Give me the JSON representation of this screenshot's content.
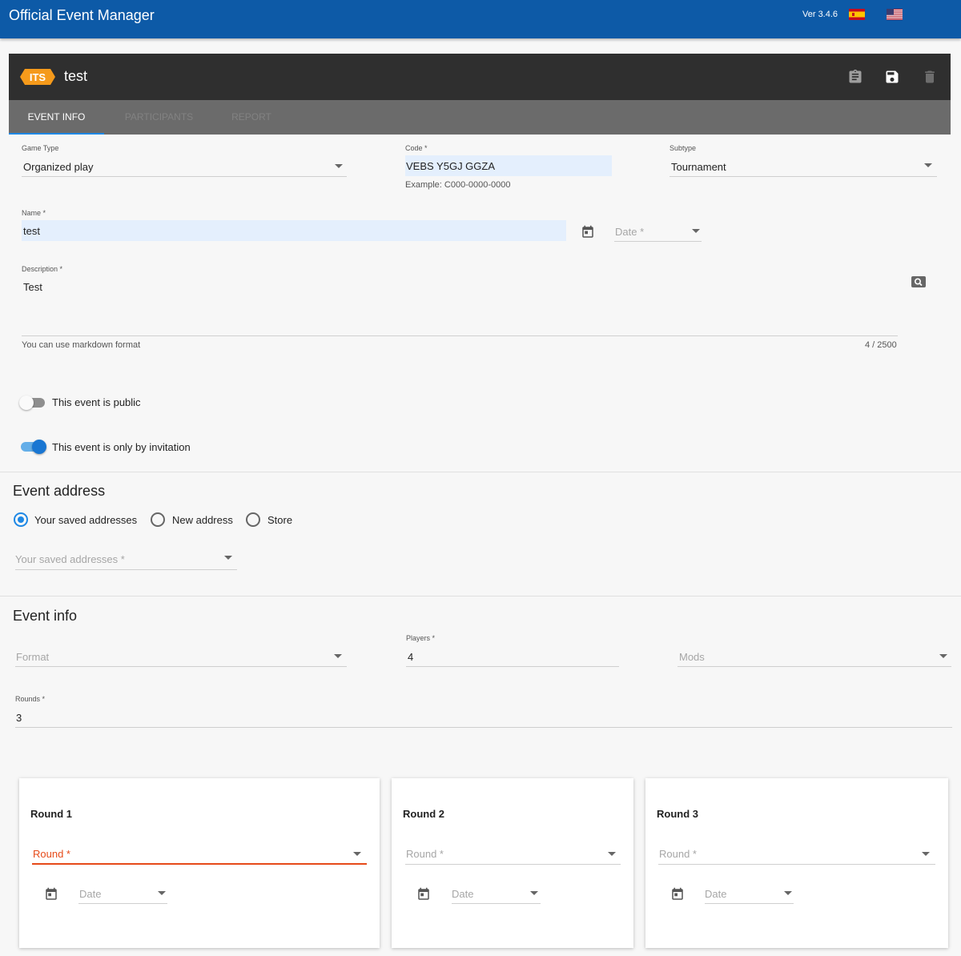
{
  "app": {
    "title": "Official Event Manager",
    "version": "Ver 3.4.6",
    "languages": [
      "es-flag-icon",
      "us-flag-icon"
    ]
  },
  "event_header": {
    "logo_text": "ITS",
    "title": "test",
    "actions": [
      "clipboard-icon",
      "save-icon",
      "delete-icon"
    ],
    "tabs": [
      {
        "label": "EVENT INFO",
        "active": true
      },
      {
        "label": "PARTICIPANTS",
        "active": false
      },
      {
        "label": "REPORT",
        "active": false
      }
    ]
  },
  "form": {
    "game_type": {
      "label": "Game Type",
      "value": "Organized play"
    },
    "code": {
      "label": "Code *",
      "value": "VEBS Y5GJ GGZA",
      "hint": "Example: C000-0000-0000"
    },
    "subtype": {
      "label": "Subtype",
      "value": "Tournament"
    },
    "name": {
      "label": "Name *",
      "value": "test"
    },
    "date": {
      "placeholder": "Date *"
    },
    "description": {
      "label": "Description *",
      "value": "Test",
      "hint": "You can use markdown format",
      "counter": "4 / 2500"
    },
    "public_toggle": {
      "label": "This event is public",
      "on": false
    },
    "invitation_toggle": {
      "label": "This event is only by invitation",
      "on": true
    }
  },
  "event_address": {
    "title": "Event address",
    "options": [
      {
        "label": "Your saved addresses",
        "selected": true
      },
      {
        "label": "New address",
        "selected": false
      },
      {
        "label": "Store",
        "selected": false
      }
    ],
    "saved_addresses": {
      "placeholder": "Your saved addresses *"
    }
  },
  "event_info": {
    "title": "Event info",
    "format": {
      "placeholder": "Format"
    },
    "players": {
      "label": "Players *",
      "value": "4"
    },
    "mods": {
      "placeholder": "Mods"
    },
    "rounds": {
      "label": "Rounds *",
      "value": "3"
    }
  },
  "rounds": [
    {
      "title": "Round 1",
      "round_placeholder": "Round *",
      "date_placeholder": "Date",
      "error": true
    },
    {
      "title": "Round 2",
      "round_placeholder": "Round *",
      "date_placeholder": "Date",
      "error": false
    },
    {
      "title": "Round 3",
      "round_placeholder": "Round *",
      "date_placeholder": "Date",
      "error": false
    }
  ],
  "colors": {
    "topbar": "#0d5aa7",
    "header_dark": "#2f2f2f",
    "tabs_bar": "#6b6b6b",
    "accent": "#1e88e5",
    "error": "#e64a19",
    "input_fill": "#e4effd"
  }
}
